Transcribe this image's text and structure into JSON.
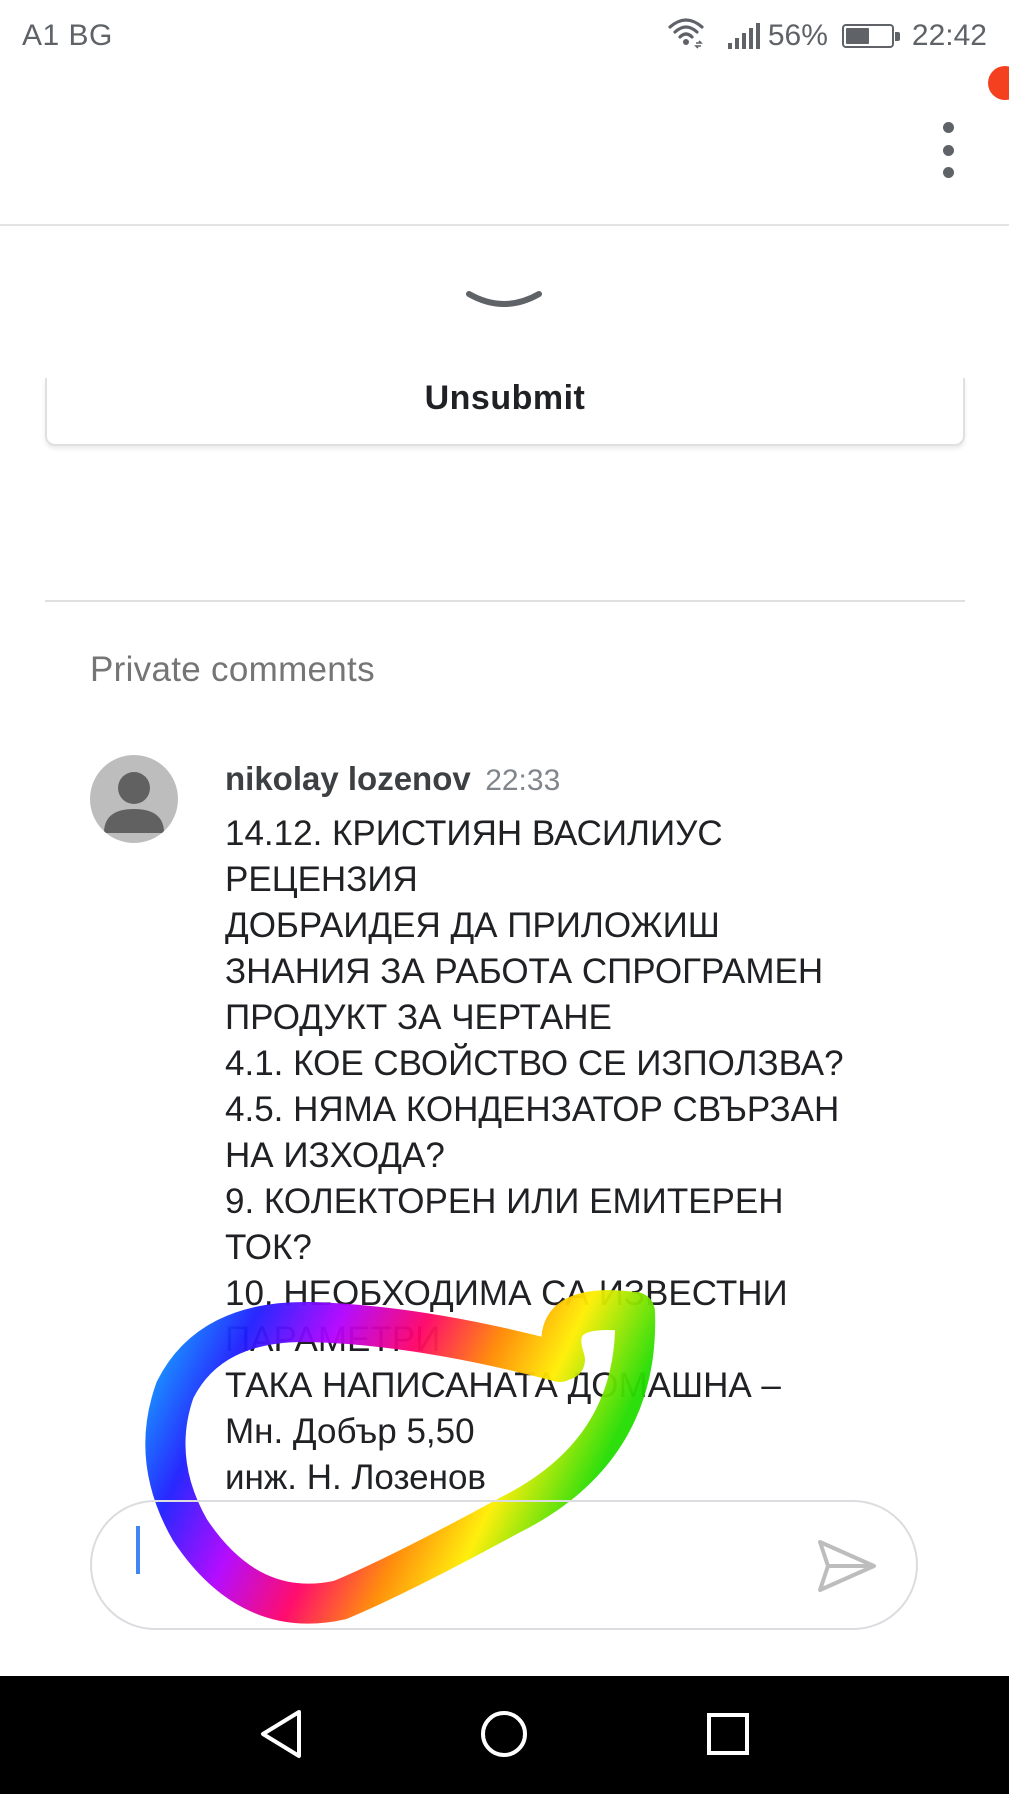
{
  "status_bar": {
    "carrier": "A1 BG",
    "wifi_icon": "wifi-icon",
    "signal_icon": "signal-bars-icon",
    "battery_percent": "56%",
    "battery_level": 0.56,
    "time": "22:42"
  },
  "app_bar": {
    "menu_icon": "more-vert-icon"
  },
  "submission": {
    "collapse_icon": "chevron-down-icon",
    "unsubmit_label": "Unsubmit"
  },
  "private_comments": {
    "title": "Private comments",
    "comments": [
      {
        "author": "nikolay lozenov",
        "time": "22:33",
        "lines": [
          "14.12. КРИСТИЯН ВАСИЛИУС",
          "РЕЦЕНЗИЯ",
          "ДОБРАИДЕЯ ДА ПРИЛОЖИШ",
          "ЗНАНИЯ ЗА РАБОТА СПРОГРАМЕН",
          "ПРОДУКТ ЗА ЧЕРТАНЕ",
          "4.1. КОЕ СВОЙСТВО СЕ ИЗПОЛЗВА?",
          "4.5. НЯМА КОНДЕНЗАТОР СВЪРЗАН",
          "НА ИЗХОДА?",
          "9. КОЛЕКТОРЕН ИЛИ ЕМИТЕРЕН",
          "ТОК?",
          "10. НЕОБХОДИМА СА ИЗВЕСТНИ",
          "ПАРАМЕТРИ",
          "ТАКА НАПИСАНАТА ДОМАШНА –",
          "Мн. Добър 5,50",
          "инж. Н. Лозенов"
        ]
      }
    ]
  },
  "compose": {
    "value": "",
    "send_icon": "send-icon"
  },
  "nav_bar": {
    "back_icon": "back-triangle-icon",
    "home_icon": "home-circle-icon",
    "recents_icon": "recents-square-icon"
  }
}
